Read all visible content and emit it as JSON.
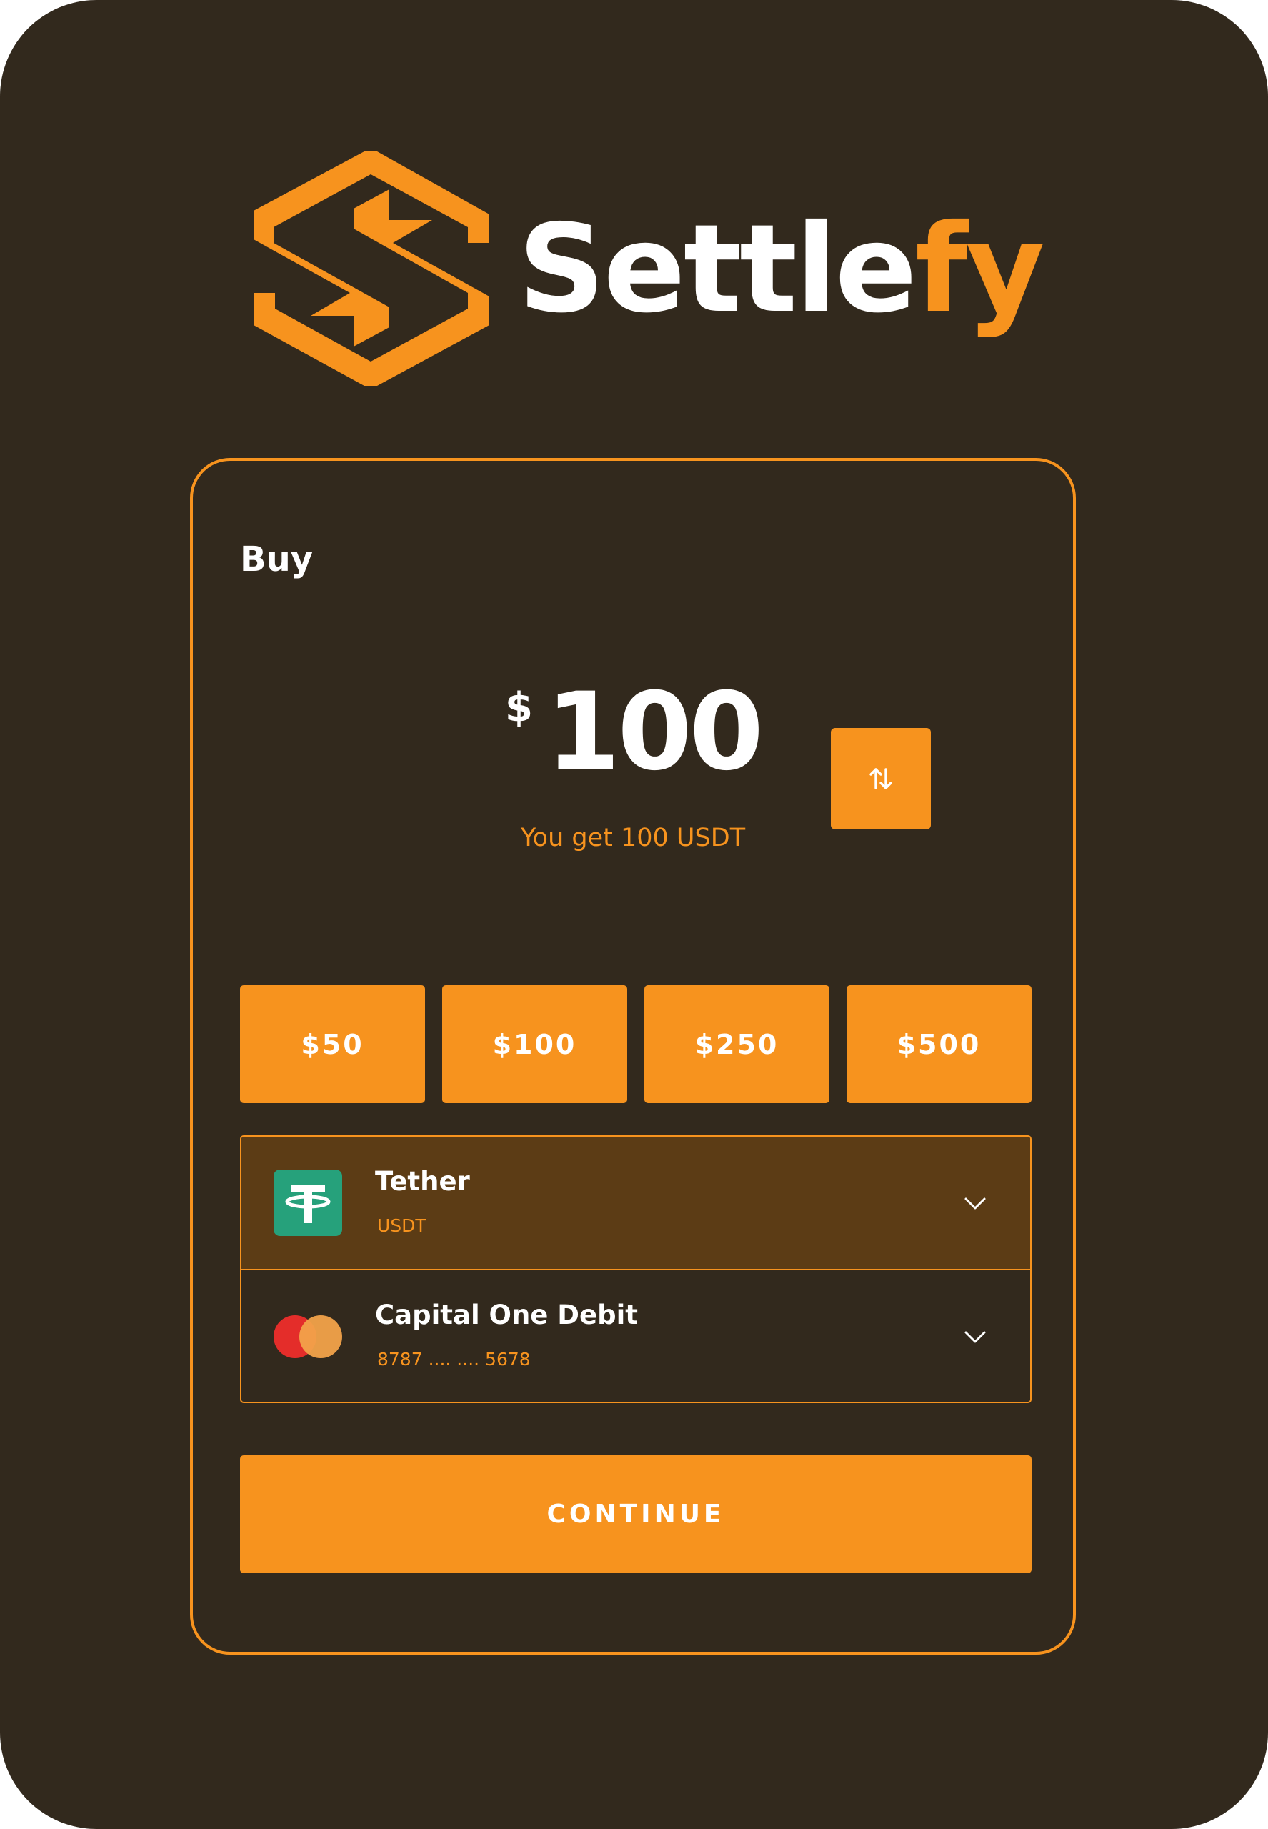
{
  "brand": {
    "name_part1": "Settle",
    "name_part2": "fy",
    "primary_color": "#f7931e",
    "background_color": "#32291d",
    "logo_icon": "exchange-hexagon-logo-icon"
  },
  "card": {
    "title": "Buy",
    "currency_symbol": "$",
    "amount": "100",
    "receive_text": "You get 100 USDT",
    "swap_icon": "swap-vertical-icon",
    "presets": [
      {
        "label": "$50"
      },
      {
        "label": "$100"
      },
      {
        "label": "$250"
      },
      {
        "label": "$500"
      }
    ],
    "asset": {
      "name": "Tether",
      "ticker": "USDT",
      "icon": "tether-icon",
      "icon_color": "#26a17b",
      "chevron": "chevron-down-icon"
    },
    "payment": {
      "name": "Capital One Debit",
      "card_number": "8787 .... .... 5678",
      "icon": "mastercard-icon",
      "chevron": "chevron-down-icon"
    },
    "continue_label": "CONTINUE"
  }
}
